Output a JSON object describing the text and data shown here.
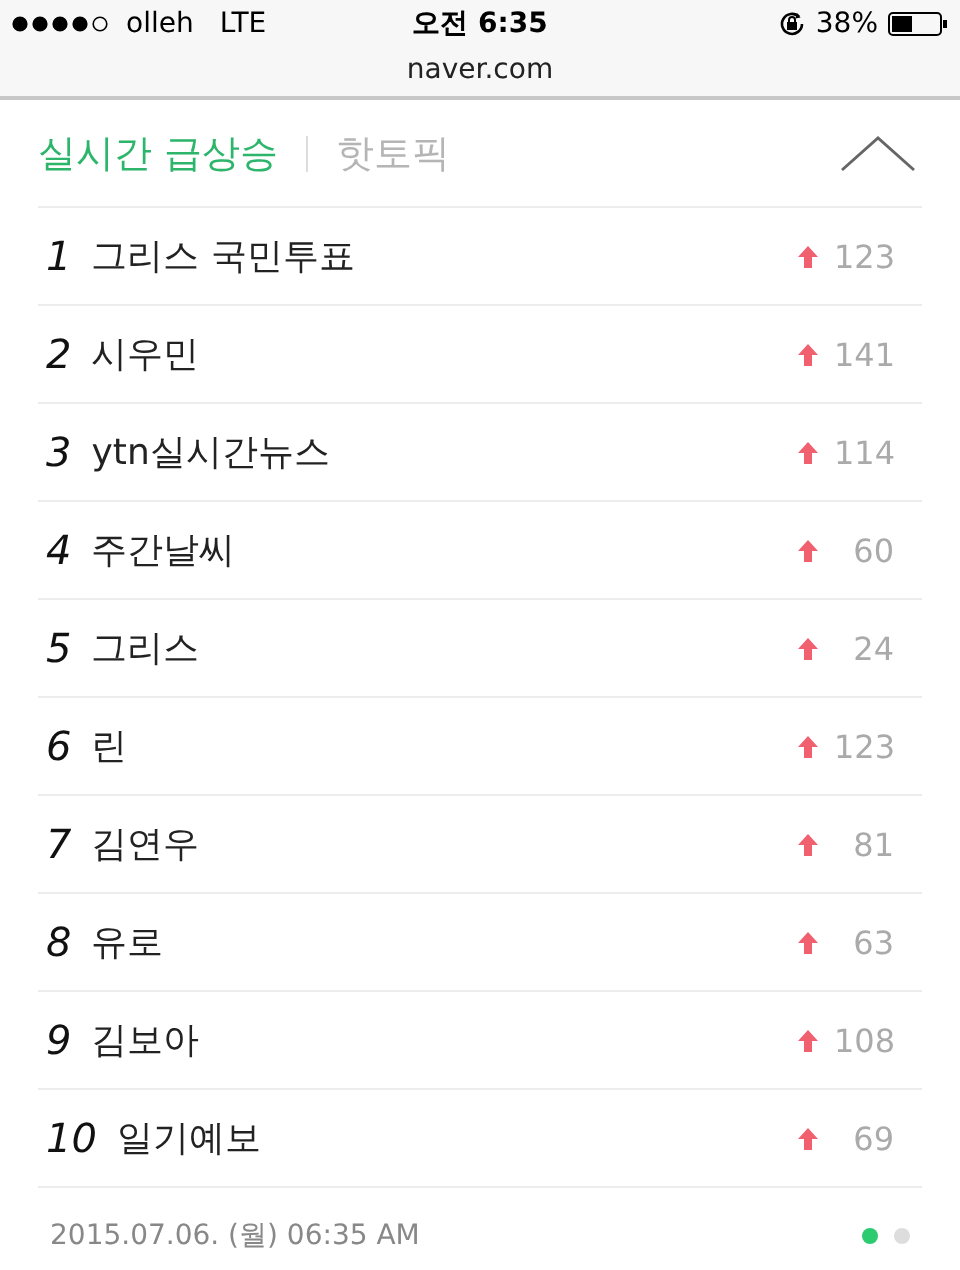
{
  "status_bar": {
    "carrier": "olleh",
    "network": "LTE",
    "time": "오전 6:35",
    "battery": "38%"
  },
  "url_bar": {
    "address": "naver.com"
  },
  "tabs": [
    {
      "label": "실시간 급상승",
      "selected": true
    },
    {
      "label": "핫토픽",
      "selected": false
    }
  ],
  "collapse": {
    "expanded": true
  },
  "rankings": [
    {
      "rank": "1",
      "keyword": "그리스 국민투표",
      "change": "123"
    },
    {
      "rank": "2",
      "keyword": "시우민",
      "change": "141"
    },
    {
      "rank": "3",
      "keyword": "ytn실시간뉴스",
      "change": "114"
    },
    {
      "rank": "4",
      "keyword": "주간날씨",
      "change": "60"
    },
    {
      "rank": "5",
      "keyword": "그리스",
      "change": "24"
    },
    {
      "rank": "6",
      "keyword": "린",
      "change": "123"
    },
    {
      "rank": "7",
      "keyword": "김연우",
      "change": "81"
    },
    {
      "rank": "8",
      "keyword": "유로",
      "change": "63"
    },
    {
      "rank": "9",
      "keyword": "김보아",
      "change": "108"
    },
    {
      "rank": "10",
      "keyword": "일기예보",
      "change": "69"
    }
  ],
  "footer": {
    "timestamp": "2015.07.06. (월) 06:35 AM",
    "pages": [
      {
        "selected": true
      },
      {
        "selected": false
      }
    ]
  }
}
